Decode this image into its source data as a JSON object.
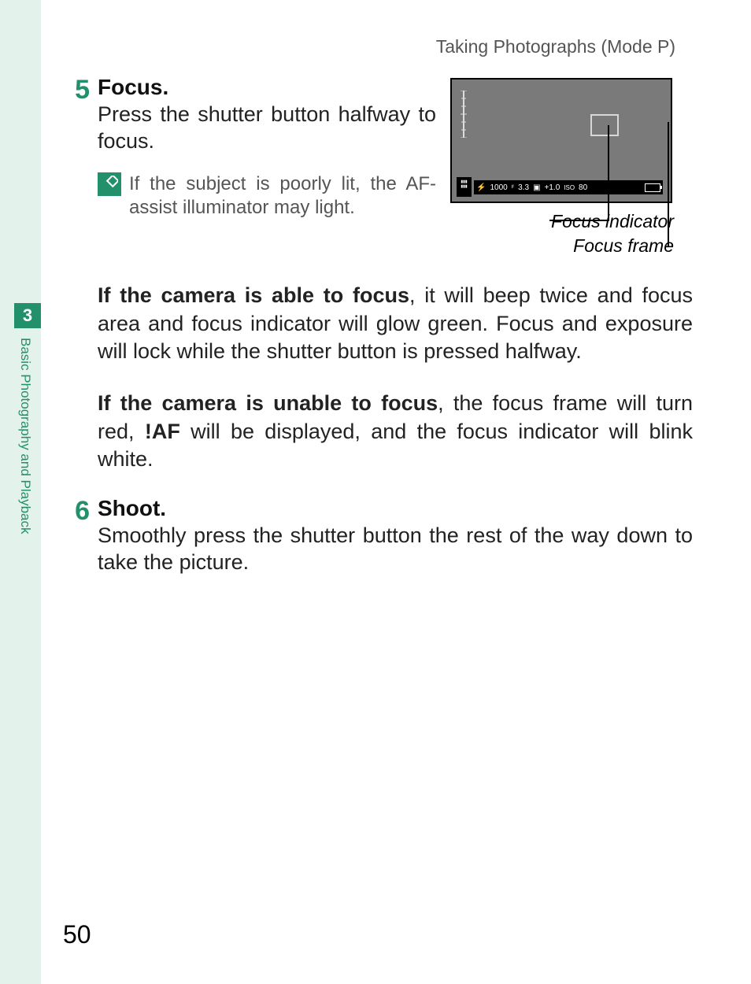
{
  "header": {
    "section_title": "Taking Photographs (Mode P)"
  },
  "sidebar": {
    "chapter_number": "3",
    "chapter_title": "Basic Photography and Playback"
  },
  "steps": {
    "s5": {
      "num": "5",
      "title": "Focus.",
      "text": "Press the shutter button halfway to focus.",
      "note": "If the subject is poorly lit, the AF-assist illuminator may light."
    },
    "s6": {
      "num": "6",
      "title": "Shoot.",
      "text": "Smoothly press the shutter button the rest of the way down to take the picture."
    }
  },
  "figure": {
    "label_indicator": "Focus indicator",
    "label_frame": "Focus frame",
    "status": {
      "shutter": "1000",
      "aperture": "3.3",
      "ev_icon": "▣",
      "ev": "+1.0",
      "iso_label": "ISO",
      "iso": "80"
    }
  },
  "paragraphs": {
    "able_bold": "If the camera is able to focus",
    "able_rest": ", it will beep twice and focus area and focus indicator will glow green. Focus and exposure will lock while the shutter button is pressed halfway.",
    "unable_bold": "If the camera is unable to focus",
    "unable_pre": ", the focus frame will turn red, ",
    "af_warn": "!AF",
    "unable_post": " will be displayed, and the focus indicator will blink white."
  },
  "page_number": "50"
}
